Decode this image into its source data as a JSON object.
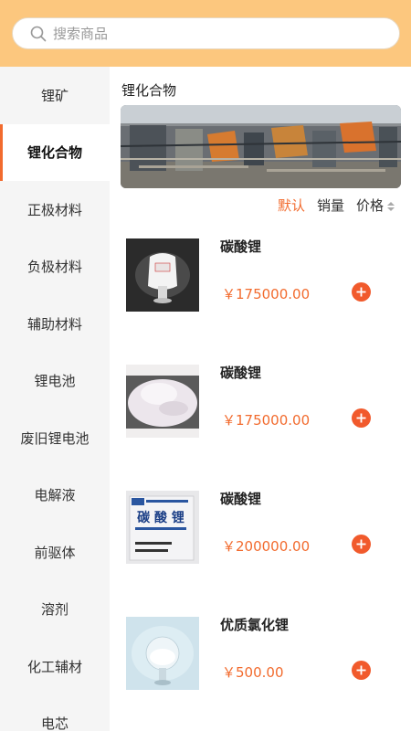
{
  "search": {
    "placeholder": "搜索商品"
  },
  "categories": [
    {
      "label": "锂矿"
    },
    {
      "label": "锂化合物"
    },
    {
      "label": "正极材料"
    },
    {
      "label": "负极材料"
    },
    {
      "label": "辅助材料"
    },
    {
      "label": "锂电池"
    },
    {
      "label": "废旧锂电池"
    },
    {
      "label": "电解液"
    },
    {
      "label": "前驱体"
    },
    {
      "label": "溶剂"
    },
    {
      "label": "化工辅材"
    },
    {
      "label": "电芯"
    }
  ],
  "active_category": "锂化合物",
  "section": {
    "title": "锂化合物"
  },
  "sort": {
    "default_label": "默认",
    "sales_label": "销量",
    "price_label": "价格"
  },
  "products": [
    {
      "name": "碳酸锂",
      "price": "￥175000.00",
      "image": "white-powder-bottle"
    },
    {
      "name": "碳酸锂",
      "price": "￥175000.00",
      "image": "white-powder-pile"
    },
    {
      "name": "碳酸锂",
      "price": "￥200000.00",
      "image": "lithium-carbonate-bag",
      "image_text": "碳 酸 锂"
    },
    {
      "name": "优质氯化锂",
      "price": "￥500.00",
      "image": "flask-white-powder"
    }
  ],
  "colors": {
    "accent": "#f26b2e",
    "header": "#fcc77e",
    "add_button": "#f15a2c",
    "sidebar_bg": "#f5f5f5"
  }
}
